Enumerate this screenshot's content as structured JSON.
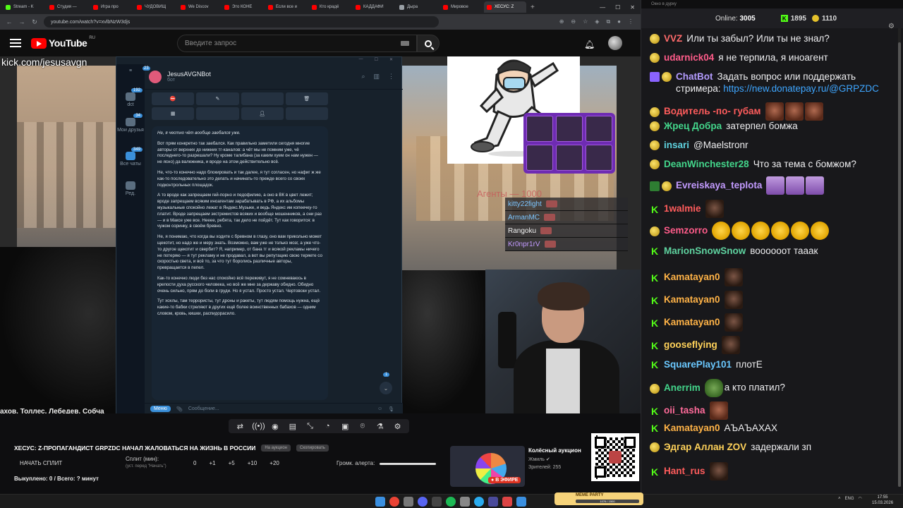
{
  "browser": {
    "tabs": [
      {
        "label": "Stream - K",
        "color": "#53fc18",
        "active": false
      },
      {
        "label": "Студия —",
        "color": "#ff0000",
        "active": false
      },
      {
        "label": "Игра про",
        "color": "#ff0000",
        "active": false
      },
      {
        "label": "ЧУДОВИЩ",
        "color": "#ff0000",
        "active": false
      },
      {
        "label": "We Discov",
        "color": "#ff0000",
        "active": false
      },
      {
        "label": "Это КОНЕ",
        "color": "#ff0000",
        "active": false
      },
      {
        "label": "Если все и",
        "color": "#ff0000",
        "active": false
      },
      {
        "label": "Кто крадё",
        "color": "#ff0000",
        "active": false
      },
      {
        "label": "КАДДАФИ",
        "color": "#ff0000",
        "active": false
      },
      {
        "label": "Дыра",
        "color": "#9aa0a6",
        "active": false
      },
      {
        "label": "Мировое",
        "color": "#ff0000",
        "active": false
      },
      {
        "label": "ХЕСУС: Z",
        "color": "#ff0000",
        "active": true
      }
    ],
    "url": "youtube.com/watch?v=xvlbNzW3djs"
  },
  "youtube": {
    "logo_text": "YouTube",
    "region": "RU",
    "search_placeholder": "Введите запрос"
  },
  "stream": {
    "kick_url": "kick.com/jesusavgn",
    "names_ticker": "ахов, Толлес, Лебедев, Собча",
    "agents_label": "Агенты — 1000",
    "viewers": [
      {
        "name": "kitty22fight",
        "color": "#7cc5ff"
      },
      {
        "name": "ArmanMC",
        "color": "#7cc5ff"
      },
      {
        "name": "Rangoku",
        "color": "#f0f0f0"
      },
      {
        "name": "Kr0npr1rV",
        "color": "#c39bff"
      }
    ]
  },
  "telegram": {
    "sidebar": [
      {
        "label": "dct",
        "badge": "192"
      },
      {
        "label": "Мои друзья",
        "badge": "34"
      },
      {
        "label": "Все чаты",
        "badge": "349"
      },
      {
        "label": "Ред.",
        "badge": ""
      }
    ],
    "chat_name": "JesusAVGNBot",
    "chat_status": "бот",
    "avatar_badge": "23",
    "down_badge": "1",
    "menu_label": "Меню",
    "input_placeholder": "Сообщение...",
    "message": [
      "Не, я честно чёт вообще заебался уже.",
      "Вот прям конкретно так заебался. Как правильно заметили сегодня многие авторы от верхних до нижних тг-каналов: а чёт мы не помним уже, чё последнего-то разрешали? Ну кроме талибана (за каким хуем он нам нужен — не ясно) да валежника, и вроде на этом действительно всё.",
      "Не, что-то конечно надо блокировать и так далее, я тут согласен, но нафиг ж же как-то последовательно это делать и начинать-то прежде всего со своих подконтрольных площадок.",
      "А то вроде как запрещаем гей-порно и педофилию, а оно в ВК в цвет лежит; вроде запрещаем всяким иноагентам зарабатывать в РФ, а их альбомы музыкальные спокойно лежат в Яндекс.Музыке, и ведь Яндекс им копеечку-то платит. Вроде запрещаем экстремистов всяких и вообще мошенников, а они раз — и в Максе уже все. Нееее, ребята, так дело не пойдёт. Тут как говорится: в чужом соринку, в своём бревно.",
      "Не, я понимаю, что когда вы ходите с бревном в глазу, оно вам прикольно может щекотит, но надо же и меру знать. Возможно, вам уже не только мозг, а уже что-то другое щекотит и свербит? Я, например, от бана тг и всякой рекламы ничего не потеряю — я тут рекламу и не продавал, а вот вы репутацию свою теряете со скоростью света, и всё то, за что тут боролись различные авторы, превращается в пепел.",
      "Как-то конечно люди без нас спокойно всё переживут, я не сомневаюсь в крепости духа русского человека, но всё же мне за державу обидно. Обидно очень сильно, прям до боли в груди. Но я устал. Просто устал. Чертовски устал.",
      "Тут хохлы, там террористы, тут дроны и ракеты, тут людям помощь нужна, ещё какие-то бабки стреляют в других ещё более воинственных бабахов — одним словом, кровь, кишки, распидорасило."
    ]
  },
  "bottom": {
    "title": "ХЕСУС: Z-ПРОПАГАНДИСТ GRPZDC НАЧАЛ ЖАЛОВАТЬСЯ НА ЖИЗНЬ В РОССИИ",
    "pill1": "На аукцион",
    "pill2": "Скопировать",
    "split_button": "НАЧАТЬ СПЛИТ",
    "split_label": "Сплит (мин):",
    "split_sub": "(уст. перед \"Начать\")",
    "steps": [
      "0",
      "+1",
      "+5",
      "+10",
      "+20"
    ],
    "alert_label": "Громк. алерта:",
    "alert_volume": 1.0,
    "bought": "Выкуплено: 0 / Всего: ? минут",
    "auction_name": "Колёсный аукцион",
    "auction_channel": "Жмиль",
    "auction_viewers": "Зрителей: 255",
    "live_label": "В ЭФИРЕ"
  },
  "taskbar": {
    "meme_label": "MEME PARTY",
    "meme_progress": "1076 / 1500",
    "lang": "ENG",
    "time": "17:55",
    "date": "15.03.2026"
  },
  "chat": {
    "title": "Окно в дурку",
    "online_label": "Online:",
    "online_count": "3005",
    "k_count": "1895",
    "points_count": "1110",
    "messages": [
      {
        "badges": [
          "coin"
        ],
        "user": "VVZ",
        "color": "#ff6b6b",
        "text": "Или ты забыл? Или ты не знал?",
        "emotes": []
      },
      {
        "badges": [
          "coin"
        ],
        "user": "udarnick04",
        "color": "#ff5c8a",
        "text": "я не терпила, я иноагент",
        "emotes": []
      },
      {
        "badges": [
          "bot",
          "coin"
        ],
        "user": "ChatBot",
        "color": "#b49cff",
        "text": "Задать вопрос или поддержать стримера: ",
        "link": "https://new.donatepay.ru/@GRPZDC",
        "emotes": []
      },
      {
        "badges": [
          "coin"
        ],
        "user": "Водитель -по- губам",
        "color": "#ff5c5c",
        "text": "",
        "emotes": [
          "em-face",
          "em-face",
          "em-face"
        ]
      },
      {
        "badges": [
          "coin"
        ],
        "user": "Жрец Добра",
        "color": "#43d68b",
        "text": "затерпел бомжа",
        "emotes": []
      },
      {
        "badges": [
          "coin"
        ],
        "user": "insari",
        "color": "#5fd3e0",
        "text": "@Maelstronr",
        "emotes": []
      },
      {
        "badges": [
          "coin"
        ],
        "user": "DeanWinchester28",
        "color": "#43d68b",
        "text": "Что за тема с бомжом?",
        "emotes": []
      },
      {
        "badges": [
          "pencil",
          "coin"
        ],
        "user": "Evreiskaya_teplota",
        "color": "#c39bff",
        "text": "",
        "emotes": [
          "em-purple",
          "em-purple",
          "em-purple"
        ]
      },
      {
        "badges": [
          "k"
        ],
        "user": "1walmie",
        "color": "#ff5c5c",
        "text": "",
        "emotes": [
          "em-dark"
        ]
      },
      {
        "badges": [
          "coin"
        ],
        "user": "Semzorro",
        "color": "#ff5c8a",
        "text": "",
        "emotes": [
          "em-laugh",
          "em-laugh",
          "em-laugh",
          "em-laugh",
          "em-laugh",
          "em-laugh"
        ]
      },
      {
        "badges": [
          "k"
        ],
        "user": "MarionSnowSnow",
        "color": "#5fd3a0",
        "text": "воооооот тааак",
        "emotes": []
      },
      {
        "badges": [
          "k"
        ],
        "user": "Kamatayan0",
        "color": "#ffb347",
        "text": "",
        "emotes": [
          "em-dark"
        ]
      },
      {
        "badges": [
          "k"
        ],
        "user": "Kamatayan0",
        "color": "#ffb347",
        "text": "",
        "emotes": [
          "em-dark"
        ]
      },
      {
        "badges": [
          "k"
        ],
        "user": "Kamatayan0",
        "color": "#ffb347",
        "text": "",
        "emotes": [
          "em-dark"
        ]
      },
      {
        "badges": [
          "k"
        ],
        "user": "gooseflying",
        "color": "#ffd25a",
        "text": "",
        "emotes": [
          "em-dark"
        ]
      },
      {
        "badges": [
          "k"
        ],
        "user": "SquarePlay101",
        "color": "#6ac8ff",
        "text": "плотЕ",
        "emotes": []
      },
      {
        "badges": [
          "coin"
        ],
        "user": "Anerrim",
        "color": "#43d68b",
        "text": "а кто платил?",
        "emotes": [
          "em-pepe"
        ]
      },
      {
        "badges": [
          "k"
        ],
        "user": "oii_tasha",
        "color": "#ff6b9a",
        "text": "",
        "emotes": [
          "em-face"
        ]
      },
      {
        "badges": [
          "k"
        ],
        "user": "Kamatayan0",
        "color": "#ffb347",
        "text": "АЪАЪАХАХ",
        "emotes": []
      },
      {
        "badges": [
          "coin"
        ],
        "user": "Эдгар Аллан ZOV",
        "color": "#ffd25a",
        "text": "задержали зп",
        "emotes": []
      },
      {
        "badges": [
          "k"
        ],
        "user": "Hant_rus",
        "color": "#ff5c5c",
        "text": "",
        "emotes": [
          "em-dark"
        ]
      }
    ]
  }
}
